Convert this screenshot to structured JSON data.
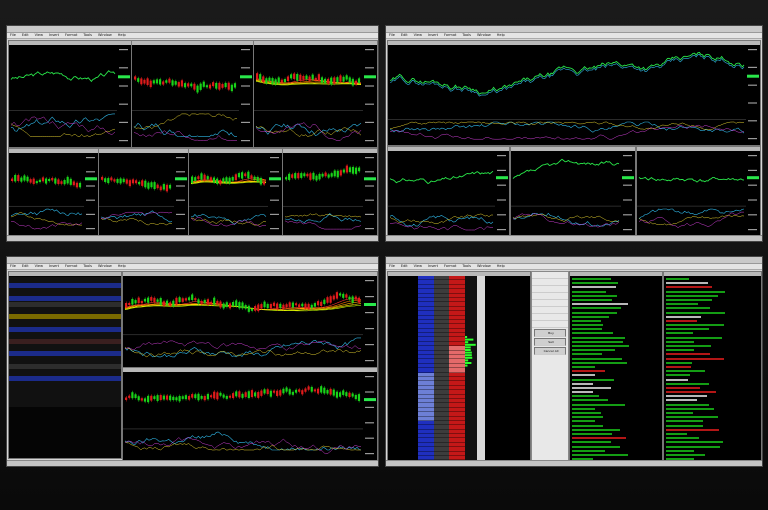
{
  "colors": {
    "background": "#000000",
    "up": "#19d419",
    "down": "#e01b1b",
    "price_line": "#29e84a",
    "indicator_cyan": "#2fb6e6",
    "indicator_yellow": "#e6d22f",
    "indicator_magenta": "#cf3fd6",
    "dom_bid": "#1f2fbf",
    "dom_ask": "#c41818",
    "chrome": "#d6d6d6"
  },
  "icons": [
    "window-close-icon",
    "window-maximize-icon",
    "window-minimize-icon"
  ],
  "monitors": {
    "top_left": {
      "menu": [
        "File",
        "Edit",
        "View",
        "Insert",
        "Format",
        "Tools",
        "Window",
        "Help"
      ]
    },
    "top_right": {
      "menu": [
        "File",
        "Edit",
        "View",
        "Insert",
        "Format",
        "Tools",
        "Window",
        "Help"
      ]
    },
    "bottom_left": {
      "menu": [
        "File",
        "Edit",
        "View",
        "Insert",
        "Format",
        "Tools",
        "Window",
        "Help"
      ]
    },
    "bottom_right": {
      "menu": [
        "File",
        "Edit",
        "View",
        "Insert",
        "Format",
        "Tools",
        "Window",
        "Help"
      ],
      "order_entry": {
        "buttons": [
          "Buy",
          "Sell",
          "Cancel All"
        ]
      }
    }
  }
}
